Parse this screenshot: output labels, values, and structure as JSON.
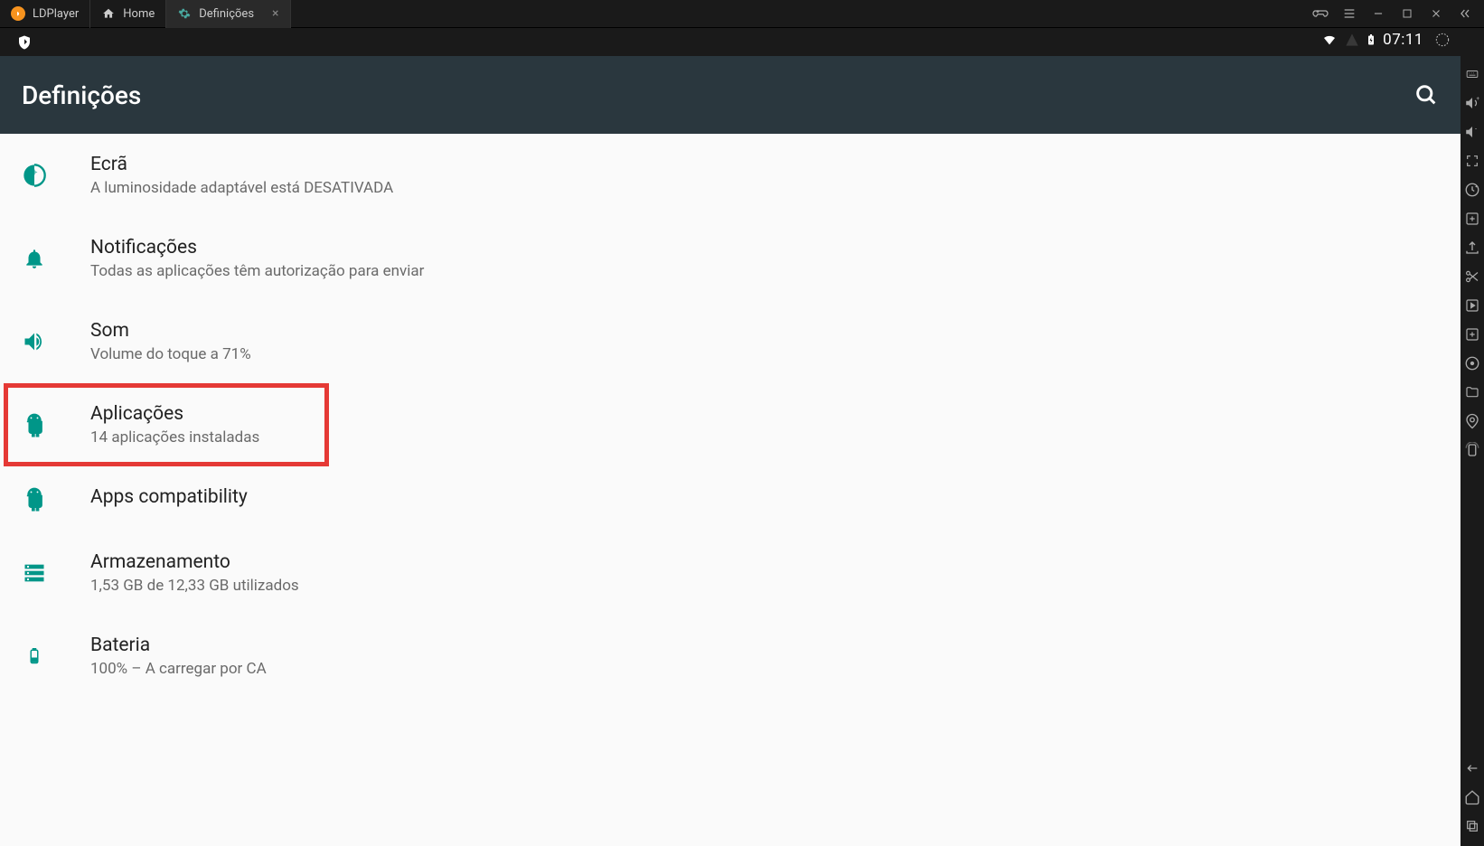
{
  "titlebar": {
    "tabs": [
      {
        "label": "LDPlayer",
        "icon": "ldplayer-logo",
        "active": false
      },
      {
        "label": "Home",
        "icon": "home-icon",
        "active": false
      },
      {
        "label": "Definições",
        "icon": "settings-gear-icon",
        "active": true,
        "closable": true
      }
    ]
  },
  "status": {
    "time": "07:11",
    "wifi": true,
    "battery_charging": true
  },
  "app_bar": {
    "title": "Definições"
  },
  "settings": [
    {
      "icon": "display-icon",
      "title": "Ecrã",
      "subtitle": "A luminosidade adaptável está DESATIVADA"
    },
    {
      "icon": "bell-icon",
      "title": "Notificações",
      "subtitle": "Todas as aplicações têm autorização para enviar"
    },
    {
      "icon": "volume-icon",
      "title": "Som",
      "subtitle": "Volume do toque a 71%"
    },
    {
      "icon": "android-icon",
      "title": "Aplicações",
      "subtitle": "14 aplicações instaladas",
      "highlighted": true
    },
    {
      "icon": "android-icon",
      "title": "Apps compatibility",
      "subtitle": ""
    },
    {
      "icon": "storage-icon",
      "title": "Armazenamento",
      "subtitle": "1,53 GB de 12,33 GB utilizados"
    },
    {
      "icon": "battery-icon",
      "title": "Bateria",
      "subtitle": "100% – A carregar por CA"
    }
  ],
  "sidebar_tools": [
    "keyboard-icon",
    "volume-up-icon",
    "volume-down-icon",
    "fullscreen-icon",
    "clock-icon",
    "plus-square-icon",
    "upload-icon",
    "scissors-icon",
    "play-square-icon",
    "square-plus-icon",
    "disc-icon",
    "folder-icon",
    "location-icon",
    "rotate-icon"
  ],
  "sidebar_bottom": [
    "back-nav-icon",
    "home-nav-icon",
    "recent-nav-icon"
  ],
  "colors": {
    "teal": "#009688",
    "appbar": "#2a373e",
    "highlight": "#e53935"
  }
}
